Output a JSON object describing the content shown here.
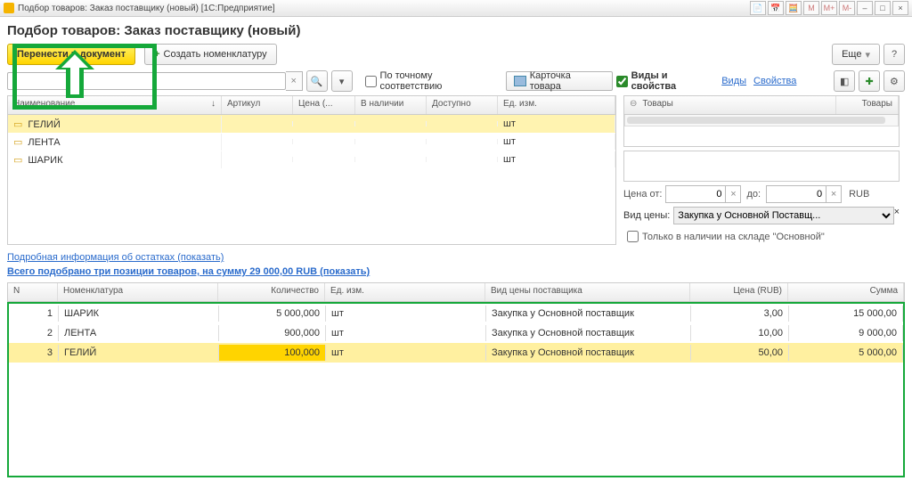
{
  "window": {
    "title": "Подбор товаров: Заказ поставщику (новый)  [1С:Предприятие]"
  },
  "header": {
    "title": "Подбор товаров: Заказ поставщику (новый)"
  },
  "toolbar": {
    "transfer": "Перенести в документ",
    "create_nomenclature": "Создать номенклатуру",
    "more": "Еще",
    "help": "?"
  },
  "filter": {
    "search_value": "",
    "exact_match": "По точному соответствию",
    "card": "Карточка товара"
  },
  "goods_grid": {
    "cols": {
      "name": "Наименование",
      "art": "Артикул",
      "price": "Цена (...",
      "stock": "В наличии",
      "avail": "Доступно",
      "unit": "Ед. изм."
    },
    "rows": [
      {
        "name": "ГЕЛИЙ",
        "unit": "шт",
        "sel": true
      },
      {
        "name": "ЛЕНТА",
        "unit": "шт",
        "sel": false
      },
      {
        "name": "ШАРИК",
        "unit": "шт",
        "sel": false
      }
    ]
  },
  "right": {
    "kinds_props": "Виды и свойства",
    "kinds": "Виды",
    "props": "Свойства",
    "tree_col": "Товары",
    "tree_val": "Товары",
    "price_from": "Цена от:",
    "from_val": "0",
    "price_to": "до:",
    "to_val": "0",
    "currency": "RUB",
    "price_type_label": "Вид цены:",
    "price_type_value": "Закупка у Основной Поставщ...",
    "stock_only": "Только в наличии на складе \"Основной\""
  },
  "links": {
    "details": "Подробная информация об остатках (показать)",
    "summary": "Всего подобрано три позиции товаров, на сумму 29 000,00 RUB (показать)"
  },
  "picked": {
    "cols": {
      "n": "N",
      "nom": "Номенклатура",
      "qty": "Количество",
      "unit": "Ед. изм.",
      "ptype": "Вид цены поставщика",
      "price": "Цена (RUB)",
      "sum": "Сумма"
    },
    "rows": [
      {
        "n": "1",
        "nom": "ШАРИК",
        "qty": "5 000,000",
        "unit": "шт",
        "ptype": "Закупка у Основной поставщик",
        "price": "3,00",
        "sum": "15 000,00",
        "sel": false
      },
      {
        "n": "2",
        "nom": "ЛЕНТА",
        "qty": "900,000",
        "unit": "шт",
        "ptype": "Закупка у Основной поставщик",
        "price": "10,00",
        "sum": "9 000,00",
        "sel": false
      },
      {
        "n": "3",
        "nom": "ГЕЛИЙ",
        "qty": "100,000",
        "unit": "шт",
        "ptype": "Закупка у Основной поставщик",
        "price": "50,00",
        "sum": "5 000,00",
        "sel": true
      }
    ]
  },
  "winbtns": {
    "m": "M",
    "mp": "M+",
    "mm": "M-",
    "min": "–",
    "max": "□",
    "close": "×"
  }
}
